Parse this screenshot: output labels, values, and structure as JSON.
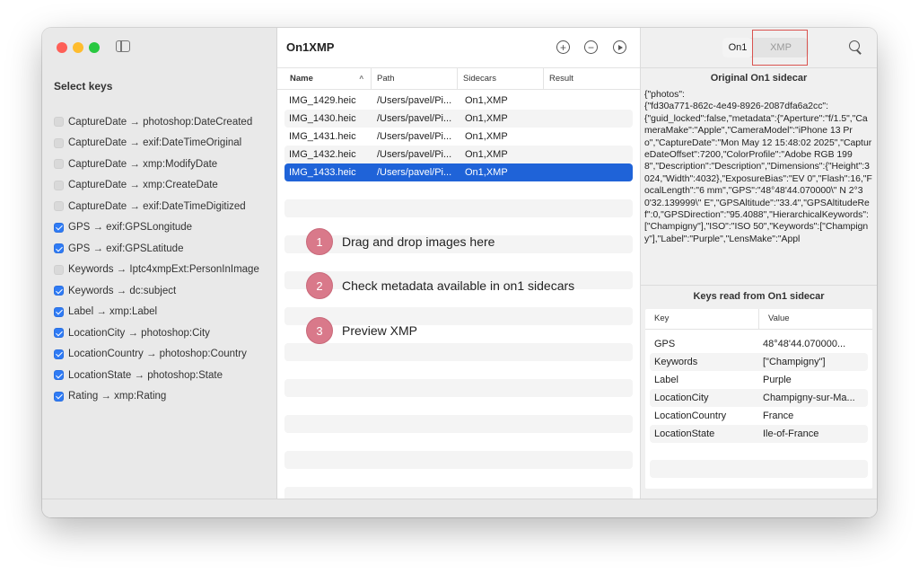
{
  "sidebar": {
    "heading": "Select keys",
    "keys": [
      {
        "label": "CaptureDate → photoshop:DateCreated",
        "checked": false
      },
      {
        "label": "CaptureDate → exif:DateTimeOriginal",
        "checked": false
      },
      {
        "label": "CaptureDate → xmp:ModifyDate",
        "checked": false
      },
      {
        "label": "CaptureDate → xmp:CreateDate",
        "checked": false
      },
      {
        "label": "CaptureDate → exif:DateTimeDigitized",
        "checked": false
      },
      {
        "label": "GPS → exif:GPSLongitude",
        "checked": true
      },
      {
        "label": "GPS → exif:GPSLatitude",
        "checked": true
      },
      {
        "label": "Keywords → Iptc4xmpExt:PersonInImage",
        "checked": false
      },
      {
        "label": "Keywords → dc:subject",
        "checked": true
      },
      {
        "label": "Label → xmp:Label",
        "checked": true
      },
      {
        "label": "LocationCity → photoshop:City",
        "checked": true
      },
      {
        "label": "LocationCountry → photoshop:Country",
        "checked": true
      },
      {
        "label": "LocationState → photoshop:State",
        "checked": true
      },
      {
        "label": "Rating → xmp:Rating",
        "checked": true
      }
    ]
  },
  "toolbar": {
    "title": "On1XMP",
    "add_label": "+",
    "remove_label": "−"
  },
  "table": {
    "columns": [
      "Name",
      "Path",
      "Sidecars",
      "Result"
    ],
    "rows": [
      {
        "name": "IMG_1429.heic",
        "path": "/Users/pavel/Pi...",
        "sidecars": "On1,XMP",
        "result": ""
      },
      {
        "name": "IMG_1430.heic",
        "path": "/Users/pavel/Pi...",
        "sidecars": "On1,XMP",
        "result": ""
      },
      {
        "name": "IMG_1431.heic",
        "path": "/Users/pavel/Pi...",
        "sidecars": "On1,XMP",
        "result": ""
      },
      {
        "name": "IMG_1432.heic",
        "path": "/Users/pavel/Pi...",
        "sidecars": "On1,XMP",
        "result": ""
      },
      {
        "name": "IMG_1433.heic",
        "path": "/Users/pavel/Pi...",
        "sidecars": "On1,XMP",
        "result": ""
      }
    ],
    "selected_row": 4
  },
  "steps": [
    {
      "number": "1",
      "text": "Drag and drop images here"
    },
    {
      "number": "2",
      "text": "Check metadata available in on1 sidecars"
    },
    {
      "number": "3",
      "text": "Preview XMP"
    }
  ],
  "right": {
    "segment_on1": "On1",
    "segment_xmp": "XMP",
    "original_title": "Original On1 sidecar",
    "original_json": "{\"photos\":\n{\"fd30a771-862c-4e49-8926-2087dfa6a2cc\":\n{\"guid_locked\":false,\"metadata\":{\"Aperture\":\"f/1.5\",\"CameraMake\":\"Apple\",\"CameraModel\":\"iPhone 13 Pro\",\"CaptureDate\":\"Mon May 12 15:48:02 2025\",\"CaptureDateOffset\":7200,\"ColorProfile\":\"Adobe RGB 1998\",\"Description\":\"Description\",\"Dimensions\":{\"Height\":3024,\"Width\":4032},\"ExposureBias\":\"EV 0\",\"Flash\":16,\"FocalLength\":\"6 mm\",\"GPS\":\"48°48'44.070000\\\" N 2°30'32.139999\\\" E\",\"GPSAltitude\":\"33.4\",\"GPSAltitudeRef\":0,\"GPSDirection\":\"95.4088\",\"HierarchicalKeywords\":[\"Champigny\"],\"ISO\":\"ISO 50\",\"Keywords\":[\"Champigny\"],\"Label\":\"Purple\",\"LensMake\":\"Appl",
    "keys_title": "Keys read from On1 sidecar",
    "kv_columns": [
      "Key",
      "Value"
    ],
    "kv_rows": [
      {
        "key": "GPS",
        "value": "48°48'44.070000..."
      },
      {
        "key": "Keywords",
        "value": "[\"Champigny\"]"
      },
      {
        "key": "Label",
        "value": "Purple"
      },
      {
        "key": "LocationCity",
        "value": "Champigny-sur-Ma..."
      },
      {
        "key": "LocationCountry",
        "value": "France"
      },
      {
        "key": "LocationState",
        "value": "Ile-of-France"
      }
    ]
  },
  "colors": {
    "accent": "#1f63d8",
    "checkbox": "#2f7bf5",
    "step_badge": "#d9798a",
    "highlight_box": "#d9534f"
  }
}
